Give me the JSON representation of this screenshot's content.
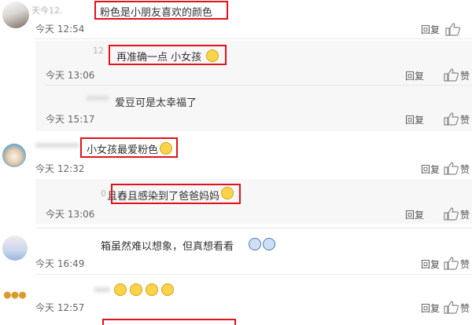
{
  "comments": [
    {
      "user": "天今12.",
      "text": "粉色是小朋友喜欢的颜色",
      "time": "今天 12:54",
      "reply": "回复",
      "like": ""
    },
    {
      "user": "12",
      "text": "再准确一点 小女孩",
      "time": "今天 13:06",
      "reply": "回复",
      "like": "赞"
    },
    {
      "user": "",
      "text": "爱豆可是太幸福了",
      "time": "今天 15:17",
      "reply": "回复",
      "like": "赞"
    },
    {
      "user": "",
      "text": "小女孩最爱粉色",
      "time": "今天 12:32",
      "reply": "回复",
      "like": "赞"
    },
    {
      "user": "0",
      "text": "且舂且感染到了爸爸妈妈",
      "time": "今天 13:06",
      "reply": "回复",
      "like": "赞"
    },
    {
      "user": "",
      "text": "箱虽然难以想象，但真想看看",
      "time": "今天 16:49",
      "reply": "回复",
      "like": "赞"
    },
    {
      "user": "",
      "text": "",
      "time": "今天 12:57",
      "reply": "回复",
      "like": "赞"
    }
  ],
  "icons": {
    "like": "thumbs-up-icon",
    "emoji": "emoji-icon"
  },
  "colors": {
    "highlight": "#e3121a",
    "subbox": "#f7f7f8"
  }
}
